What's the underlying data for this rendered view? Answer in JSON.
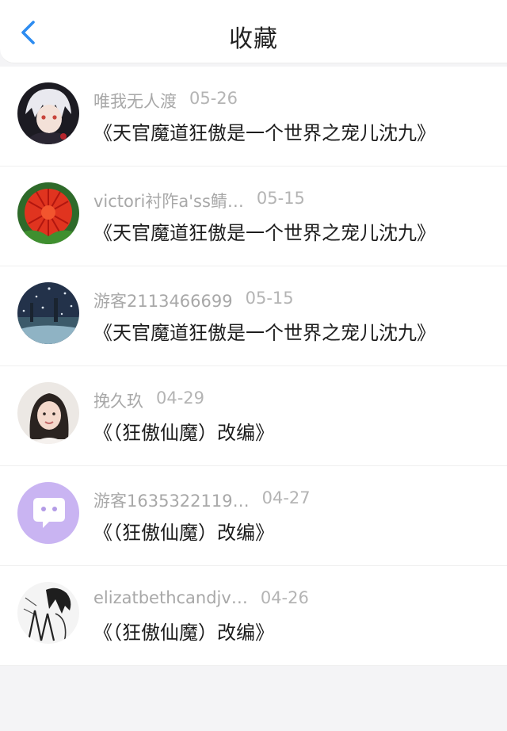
{
  "header": {
    "title": "收藏",
    "back_icon": "chevron-left-icon",
    "accent_color": "#2d8cf0"
  },
  "items": [
    {
      "username": "唯我无人渡",
      "date": "05-26",
      "title": "《天官魔道狂傲是一个世界之宠儿沈九》",
      "avatar": "anime-character-avatar"
    },
    {
      "username": "victori衬阼a'ss鲭…",
      "date": "05-15",
      "title": "《天官魔道狂傲是一个世界之宠儿沈九》",
      "avatar": "red-cactus-avatar"
    },
    {
      "username": "游客2113466699",
      "date": "05-15",
      "title": "《天官魔道狂傲是一个世界之宠儿沈九》",
      "avatar": "snowy-night-avatar"
    },
    {
      "username": "挽久玖",
      "date": "04-29",
      "title": "《（狂傲仙魔）改编》",
      "avatar": "girl-photo-avatar"
    },
    {
      "username": "游客1635322119…",
      "date": "04-27",
      "title": "《（狂傲仙魔）改编》",
      "avatar": "chat-bubble-avatar"
    },
    {
      "username": "elizatbethcandjv…",
      "date": "04-26",
      "title": "《（狂傲仙魔）改编》",
      "avatar": "sketch-avatar"
    }
  ]
}
